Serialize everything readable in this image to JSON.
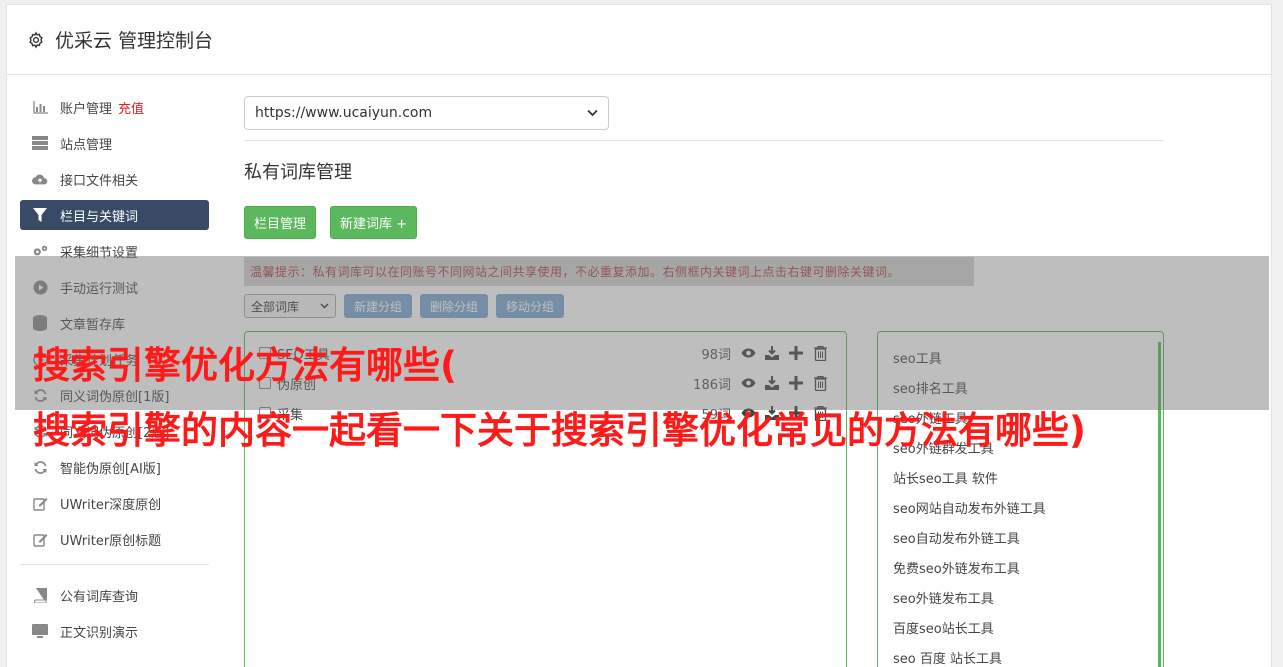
{
  "header": {
    "title": "优采云 管理控制台"
  },
  "sidebar": {
    "items": [
      {
        "label": "账户管理",
        "badge": "充值",
        "icon": "bar-chart-icon"
      },
      {
        "label": "站点管理",
        "icon": "server-icon"
      },
      {
        "label": "接口文件相关",
        "icon": "cloud-upload-icon"
      },
      {
        "label": "栏目与关键词",
        "icon": "filter-icon",
        "active": true
      },
      {
        "label": "采集细节设置",
        "icon": "gears-icon"
      },
      {
        "label": "手动运行测试",
        "icon": "play-icon"
      },
      {
        "label": "文章暂存库",
        "icon": "database-icon"
      },
      {
        "label": "采集计划任务",
        "icon": "clock-icon"
      },
      {
        "label": "同义词伪原创[1版]",
        "icon": "refresh-icon"
      },
      {
        "label": "同义词伪原创[2版]",
        "icon": "refresh-icon"
      },
      {
        "label": "智能伪原创[AI版]",
        "icon": "refresh-icon"
      },
      {
        "label": "UWriter深度原创",
        "icon": "edit-icon"
      },
      {
        "label": "UWriter原创标题",
        "icon": "edit-icon"
      }
    ],
    "items2": [
      {
        "label": "公有词库查询",
        "icon": "book-icon"
      },
      {
        "label": "正文识别演示",
        "icon": "monitor-icon"
      }
    ]
  },
  "main": {
    "site_value": "https://www.ucaiyun.com",
    "section_title": "私有词库管理",
    "btn_columns": "栏目管理",
    "btn_new_lib": "新建词库 +",
    "hint": "温馨提示：私有词库可以在同账号不同网站之间共享使用，不必重复添加。右侧框内关键词上点击右键可删除关键词。",
    "filter_value": "全部词库",
    "btn_new_group": "新建分组",
    "btn_del_group": "删除分组",
    "btn_move_group": "移动分组",
    "libraries": [
      {
        "name": "SEO工具",
        "count": "98词"
      },
      {
        "name": "伪原创",
        "count": "186词"
      },
      {
        "name": "采集",
        "count": "59词"
      }
    ],
    "keywords": [
      "seo工具",
      "seo排名工具",
      "seo外链工具",
      "seo外链群发工具",
      "站长seo工具 软件",
      "seo网站自动发布外链工具",
      "seo自动发布外链工具",
      "免费seo外链发布工具",
      "seo外链发布工具",
      "百度seo站长工具",
      "seo 百度 站长工具"
    ]
  },
  "overlay": {
    "line1": "搜索引擎优化方法有哪些(",
    "line2": "搜索引擎的内容一起看一下关于搜索引擎优化常见的方法有哪些)"
  }
}
